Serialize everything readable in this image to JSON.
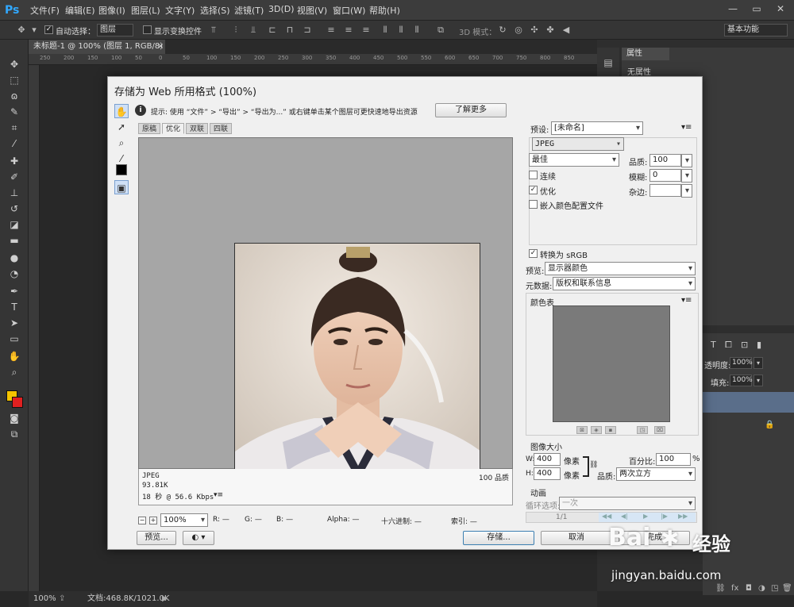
{
  "app": {
    "logo": "Ps",
    "menus": [
      "文件(F)",
      "编辑(E)",
      "图像(I)",
      "图层(L)",
      "文字(Y)",
      "选择(S)",
      "滤镜(T)",
      "3D(D)",
      "视图(V)",
      "窗口(W)",
      "帮助(H)"
    ],
    "window_controls": [
      "—",
      "▭",
      "✕"
    ]
  },
  "options_bar": {
    "auto_select_label": "自动选择：",
    "auto_select_value": "图层",
    "show_transform_label": "显示变换控件",
    "mode_3d_label": "3D 模式：",
    "workspace": "基本功能"
  },
  "document": {
    "tab_title": "未标题-1 @ 100% (图层 1, RGB/8) *",
    "tab_close": "×",
    "ruler_ticks": [
      "250",
      "200",
      "150",
      "100",
      "50",
      "0",
      "50",
      "100",
      "150",
      "200",
      "250",
      "300",
      "350",
      "400",
      "450",
      "500",
      "550",
      "600",
      "650",
      "700",
      "750",
      "800",
      "850"
    ],
    "zoom": "100%",
    "doc_info": "文档:468.8K/1021.0K"
  },
  "properties_panel": {
    "tab": "属性",
    "content": "无属性"
  },
  "layers_panel": {
    "opacity_label": "透明度:",
    "opacity_value": "100%",
    "fill_label": "填充:",
    "fill_value": "100%"
  },
  "dialog": {
    "title": "存储为 Web 所用格式 (100%)",
    "hint": "提示:  使用 “文件” > “导出” > “导出为...” 或右键单击某个图层可更快速地导出资源",
    "learn_more": "了解更多",
    "tabs": [
      "原稿",
      "优化",
      "双联",
      "四联"
    ],
    "preset_label": "预设:",
    "preset_value": "[未命名]",
    "format": "JPEG",
    "quality_preset": "最佳",
    "quality_label": "品质:",
    "quality_value": "100",
    "progressive_label": "连续",
    "blur_label": "模糊:",
    "blur_value": "0",
    "optimized_label": "优化",
    "matte_label": "杂边:",
    "embed_profile_label": "嵌入颜色配置文件",
    "convert_srgb_label": "转换为 sRGB",
    "preview_label": "预览:",
    "preview_value": "显示器颜色",
    "metadata_label": "元数据:",
    "metadata_value": "版权和联系信息",
    "color_table_label": "颜色表",
    "image_size_label": "图像大小",
    "w_label": "W:",
    "w_value": "400",
    "h_label": "H:",
    "h_value": "400",
    "px_label": "像素",
    "percent_label": "百分比:",
    "percent_value": "100",
    "percent_unit": "%",
    "resample_label": "品质:",
    "resample_value": "两次立方",
    "animation_label": "动画",
    "loop_label": "循环选项:",
    "loop_value": "一次",
    "frame_counter": "1/1",
    "info_format": "JPEG",
    "info_size": "93.81K",
    "info_time": "18 秒 @ 56.6 Kbps",
    "info_quality": "100 品质",
    "zoom_value": "100%",
    "r_label": "R: —",
    "g_label": "G: —",
    "b_label": "B: —",
    "alpha_label": "Alpha: —",
    "hex_label": "十六进制: —",
    "index_label": "索引: —",
    "preview_btn": "预览...",
    "save_btn": "存储...",
    "cancel_btn": "取消",
    "done_btn": "完成"
  },
  "watermark": {
    "brand": "Bai",
    "brand2": "经验",
    "url": "jingyan.baidu.com"
  }
}
